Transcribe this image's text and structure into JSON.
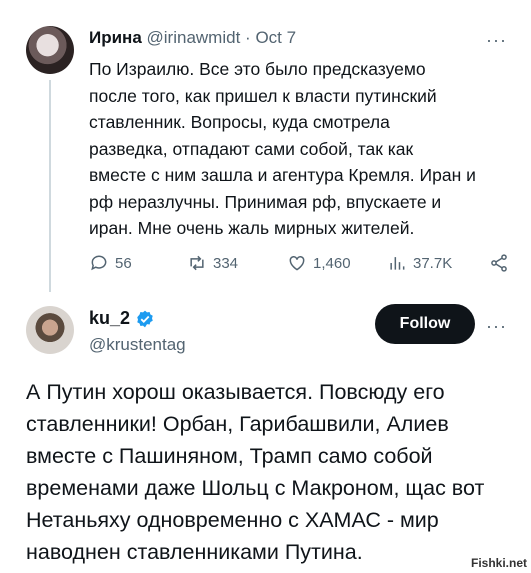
{
  "tweet1": {
    "author_name": "Ирина",
    "author_handle": "@irinawmidt",
    "separator": "·",
    "date": "Oct 7",
    "text": "По Израилю. Все это было предсказуемо\nпосле того, как пришел к власти путинский\nставленник. Вопросы, куда смотрела\nразведка, отпадают сами собой, так как\nвместе с ним зашла и агентура Кремля. Иран и\nрф неразлучны. Принимая рф, впускаете и\nиран. Мне очень жаль мирных жителей.",
    "replies": "56",
    "retweets": "334",
    "likes": "1,460",
    "views": "37.7K",
    "more": "···"
  },
  "tweet2": {
    "author_name": "ku_2",
    "author_handle": "@krustentag",
    "follow_label": "Follow",
    "more": "···",
    "text": "А Путин хорош оказывается. Повсюду его\nставленники! Орбан, Гарибашвили, Алиев\nвместе с Пашиняном, Трамп само собой\nвременами даже Шольц с Макроном, щас вот\nНетаньяху одновременно с ХАМАС - мир\nнаводнен ставленниками Путина."
  },
  "watermark": "Fishki.net",
  "colors": {
    "accent": "#1d9bf0",
    "muted": "#536471",
    "text": "#0f1419",
    "button": "#0f1419"
  }
}
